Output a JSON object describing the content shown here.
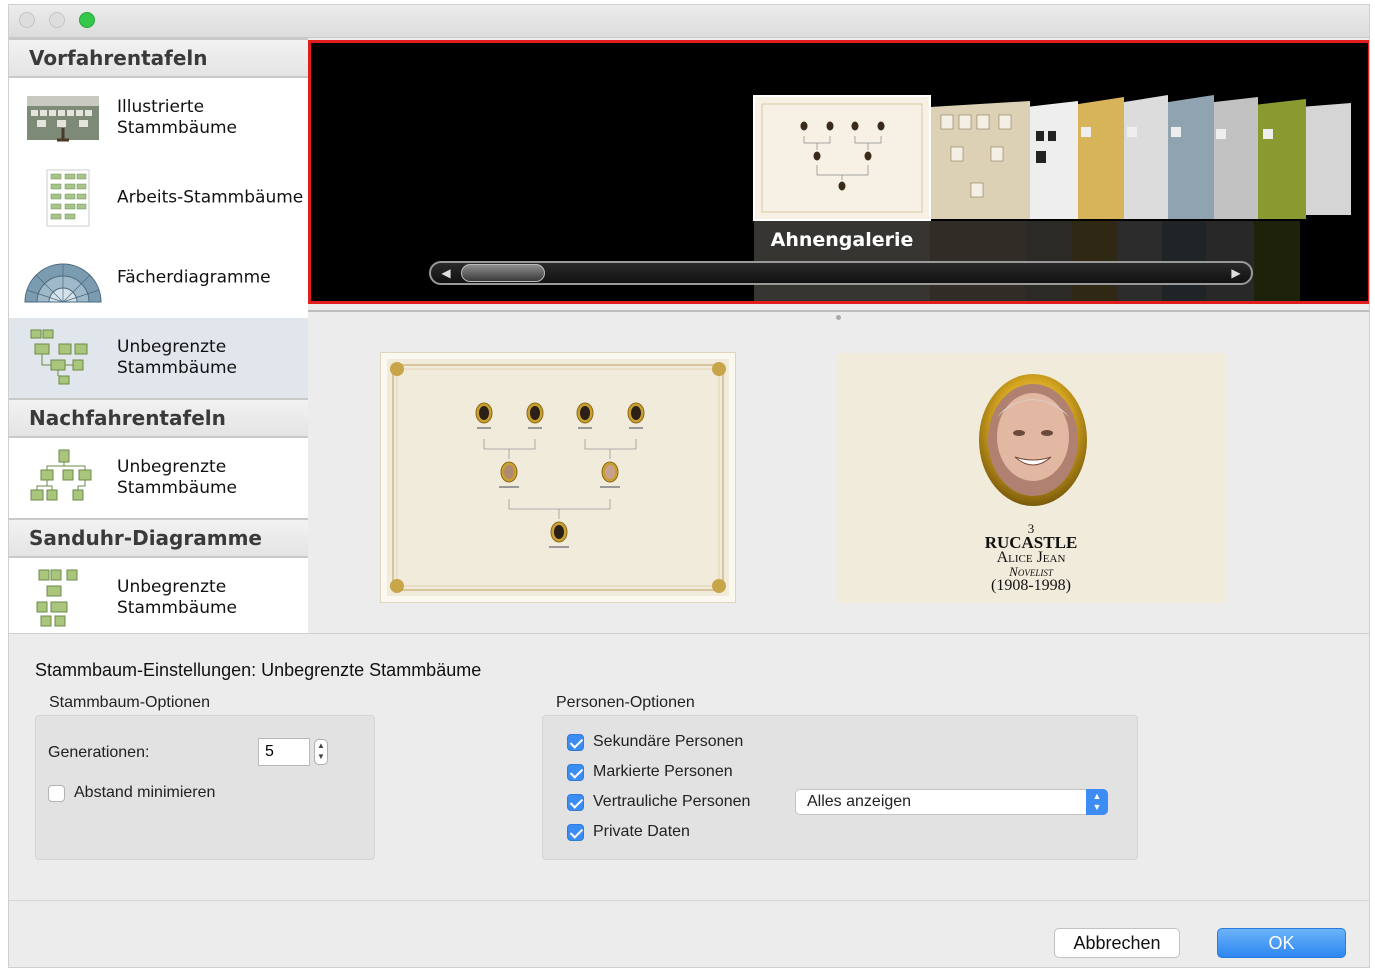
{
  "window": {
    "controls": [
      "close",
      "minimize",
      "zoom"
    ]
  },
  "sidebar": {
    "sections": [
      {
        "title": "Vorfahrentafeln",
        "items": [
          {
            "label": "Illustrierte\nStammbäume",
            "icon": "illustrated-tree-icon"
          },
          {
            "label": "Arbeits-Stammbäume",
            "icon": "working-tree-icon"
          },
          {
            "label": "Fächerdiagramme",
            "icon": "fan-chart-icon"
          },
          {
            "label": "Unbegrenzte\nStammbäume",
            "icon": "unlimited-tree-icon",
            "selected": true
          }
        ]
      },
      {
        "title": "Nachfahrentafeln",
        "items": [
          {
            "label": "Unbegrenzte\nStammbäume",
            "icon": "descendant-tree-icon"
          }
        ]
      },
      {
        "title": "Sanduhr-Diagramme",
        "items": [
          {
            "label": "Unbegrenzte\nStammbäume",
            "icon": "hourglass-tree-icon"
          }
        ]
      }
    ]
  },
  "coverflow": {
    "selected_title": "Ahnengalerie",
    "accent": "#e21d1d"
  },
  "preview": {
    "portrait_number": "3",
    "surname": "RUCASTLE",
    "given_name": "Alice Jean",
    "occupation": "Novelist",
    "dates": "(1908-1998)"
  },
  "settings": {
    "title": "Stammbaum-Einstellungen: Unbegrenzte Stammbäume",
    "tree_options": {
      "title": "Stammbaum-Optionen",
      "generations_label": "Generationen:",
      "generations_value": "5",
      "minimize_spacing_label": "Abstand minimieren",
      "minimize_spacing_checked": false
    },
    "person_options": {
      "title": "Personen-Optionen",
      "secondary_label": "Sekundäre Personen",
      "marked_label": "Markierte Personen",
      "confidential_label": "Vertrauliche Personen",
      "private_label": "Private Daten",
      "confidential_select": "Alles anzeigen"
    },
    "accent": "#3c8cf3"
  },
  "buttons": {
    "cancel": "Abbrechen",
    "ok": "OK"
  }
}
